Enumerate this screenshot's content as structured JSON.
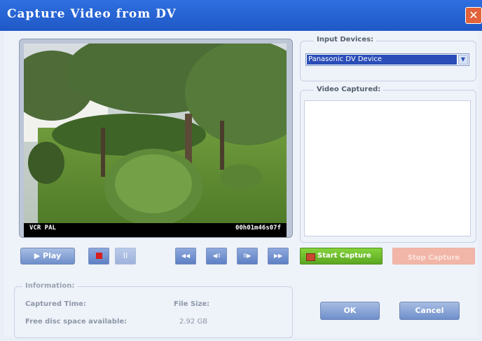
{
  "window": {
    "title": "Capture Video from DV",
    "close_symbol": "✕"
  },
  "preview": {
    "overlay_left": "VCR PAL",
    "overlay_right": "00h01m46s07f"
  },
  "input_devices": {
    "label": "Input Devices:",
    "selected": "Panasonic DV Device"
  },
  "video_captured": {
    "label": "Video Captured:"
  },
  "transport": {
    "play_label": "▶ Play",
    "rewind_symbol": "◀◀",
    "step_back_symbol": "◀II",
    "step_forward_symbol": "II▶",
    "fast_forward_symbol": "▶▶"
  },
  "capture": {
    "start_label": "Start Capture",
    "stop_label": "Stop Capture"
  },
  "information": {
    "label": "Information:",
    "captured_time_label": "Captured Time:",
    "file_size_label": "File Size:",
    "free_space_label": "Free disc space available:",
    "free_space_value": "2.92 GB"
  },
  "actions": {
    "ok_label": "OK",
    "cancel_label": "Cancel"
  },
  "colors": {
    "title_bar": "#2f6fe0",
    "start_capture": "#6cbf2a",
    "stop_capture": "#f2b6a8",
    "record": "#d81d1d"
  }
}
